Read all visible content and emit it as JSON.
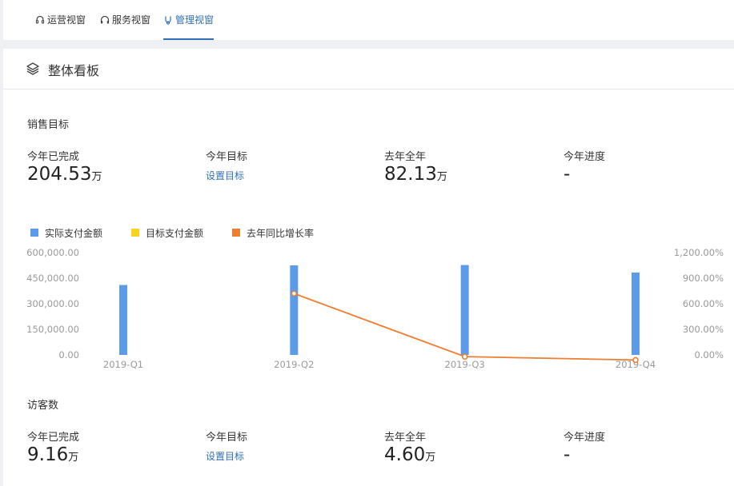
{
  "tabs": [
    {
      "label": "运营视窗",
      "icon": "headset-icon"
    },
    {
      "label": "服务视窗",
      "icon": "headphones-icon"
    },
    {
      "label": "管理视窗",
      "icon": "manager-icon",
      "active": true
    }
  ],
  "panel": {
    "title": "整体看板",
    "icon": "layers-icon"
  },
  "sales": {
    "title": "销售目标",
    "completed": {
      "label": "今年已完成",
      "value": "204.53",
      "unit": "万"
    },
    "target": {
      "label": "今年目标",
      "link": "设置目标"
    },
    "last_year": {
      "label": "去年全年",
      "value": "82.13",
      "unit": "万"
    },
    "progress": {
      "label": "今年进度",
      "value": "-"
    }
  },
  "visitors": {
    "title": "访客数",
    "completed": {
      "label": "今年已完成",
      "value": "9.16",
      "unit": "万"
    },
    "target": {
      "label": "今年目标",
      "link": "设置目标"
    },
    "last_year": {
      "label": "去年全年",
      "value": "4.60",
      "unit": "万"
    },
    "progress": {
      "label": "今年进度",
      "value": "-"
    }
  },
  "colors": {
    "accent": "#2f6fb5",
    "bar": "#5b9bea",
    "target": "#f7d51e",
    "line": "#ed7d31"
  },
  "chart_data": {
    "type": "bar",
    "categories": [
      "2019-Q1",
      "2019-Q2",
      "2019-Q3",
      "2019-Q4"
    ],
    "series": [
      {
        "name": "实际支付金额",
        "type": "bar",
        "axis": "left",
        "values": [
          410000,
          525000,
          527000,
          483000
        ]
      },
      {
        "name": "目标支付金额",
        "type": "bar",
        "axis": "left",
        "values": [
          0,
          0,
          0,
          0
        ]
      },
      {
        "name": "去年同比增长率",
        "type": "line",
        "axis": "right",
        "values": [
          null,
          720,
          -20,
          -60
        ]
      }
    ],
    "y_left": {
      "ticks": [
        "600,000.00",
        "450,000.00",
        "300,000.00",
        "150,000.00",
        "0.00"
      ],
      "tick_values": [
        600000,
        450000,
        300000,
        150000,
        0
      ],
      "ylim": [
        0,
        600000
      ]
    },
    "y_right": {
      "ticks": [
        "1,200.00%",
        "900.00%",
        "600.00%",
        "300.00%",
        "0.00%"
      ],
      "tick_values": [
        1200,
        900,
        600,
        300,
        0
      ],
      "ylim": [
        0,
        1200
      ]
    },
    "legend_position": "top-left",
    "grid": false
  }
}
